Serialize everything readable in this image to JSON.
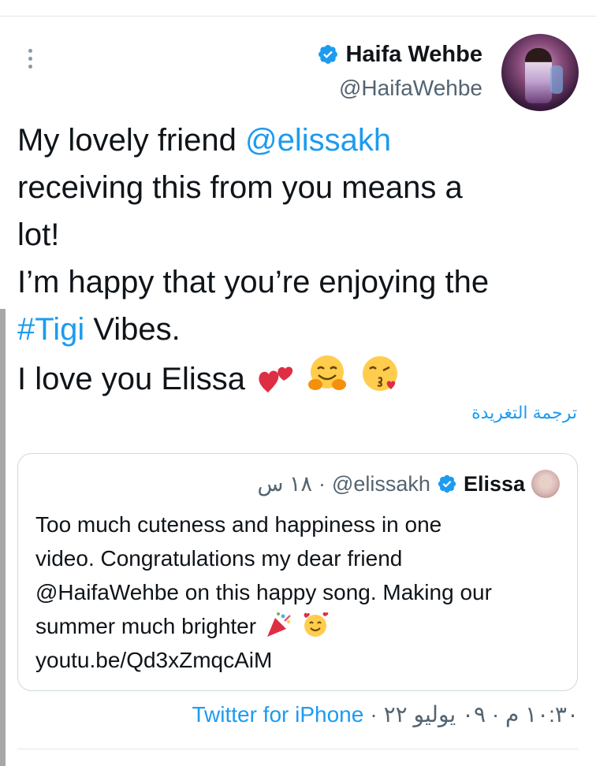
{
  "author": {
    "name": "Haifa Wehbe",
    "handle": "@HaifaWehbe"
  },
  "tweet": {
    "lines": [
      {
        "pre": "My lovely friend ",
        "link": "@elissakh",
        "post": ""
      },
      {
        "pre": "receiving this from you means a",
        "link": "",
        "post": ""
      },
      {
        "pre": "lot!",
        "link": "",
        "post": ""
      },
      {
        "pre": "I’m happy that you’re enjoying the",
        "link": "",
        "post": ""
      },
      {
        "pre": "",
        "link": "#Tigi",
        "post": " Vibes."
      },
      {
        "pre": "I love you Elissa ",
        "link": "",
        "post": ""
      }
    ],
    "emojis": [
      "two-hearts",
      "hugging-face",
      "face-blowing-kiss"
    ]
  },
  "translate_label": "ترجمة التغريدة",
  "quote": {
    "name": "Elissa",
    "handle": "@elissakh",
    "separator": "·",
    "time": "١٨ س",
    "lines": [
      "Too much cuteness and happiness in one",
      "video. Congratulations my dear friend",
      "@HaifaWehbe on this happy song. Making our",
      "summer much brighter ",
      "youtu.be/Qd3xZmqcAiM"
    ],
    "emojis": [
      "party-popper",
      "smiling-face-with-hearts"
    ]
  },
  "footer": {
    "time": "١٠:٣٠ م · ٠٩ يوليو ٢٢",
    "separator": "·",
    "source": "Twitter for iPhone"
  },
  "colors": {
    "link": "#1d9bf0",
    "text": "#0f1419",
    "secondary": "#536471",
    "border": "#cfd9de",
    "verified": "#1d9bf0",
    "left_bar": "#a7a7a7"
  },
  "icons": [
    "more-icon",
    "verified-icon"
  ]
}
